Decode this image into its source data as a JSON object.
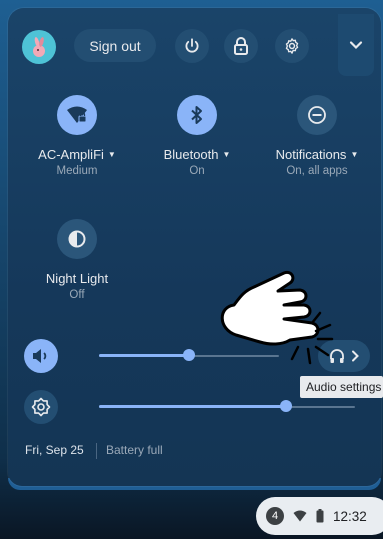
{
  "header": {
    "sign_out_label": "Sign out"
  },
  "features": [
    {
      "id": "network",
      "label": "AC-AmpliFi",
      "sub": "Medium",
      "state": "on",
      "icon": "wifi-locked-icon"
    },
    {
      "id": "bluetooth",
      "label": "Bluetooth",
      "sub": "On",
      "state": "on",
      "icon": "bluetooth-icon"
    },
    {
      "id": "notifications",
      "label": "Notifications",
      "sub": "On, all apps",
      "state": "off",
      "icon": "do-not-disturb-icon"
    },
    {
      "id": "night-light",
      "label": "Night Light",
      "sub": "Off",
      "state": "off",
      "icon": "night-light-icon"
    }
  ],
  "sliders": {
    "volume": {
      "value": 0.5,
      "icon": "volume-icon"
    },
    "brightness": {
      "value": 0.73,
      "icon": "brightness-icon"
    }
  },
  "audio_tooltip": "Audio settings",
  "footer": {
    "date": "Fri, Sep 25",
    "battery": "Battery full"
  },
  "shelf": {
    "notification_count": "4",
    "time": "12:32"
  },
  "colors": {
    "accent": "#8ab4f8",
    "panel": "#15385a"
  }
}
